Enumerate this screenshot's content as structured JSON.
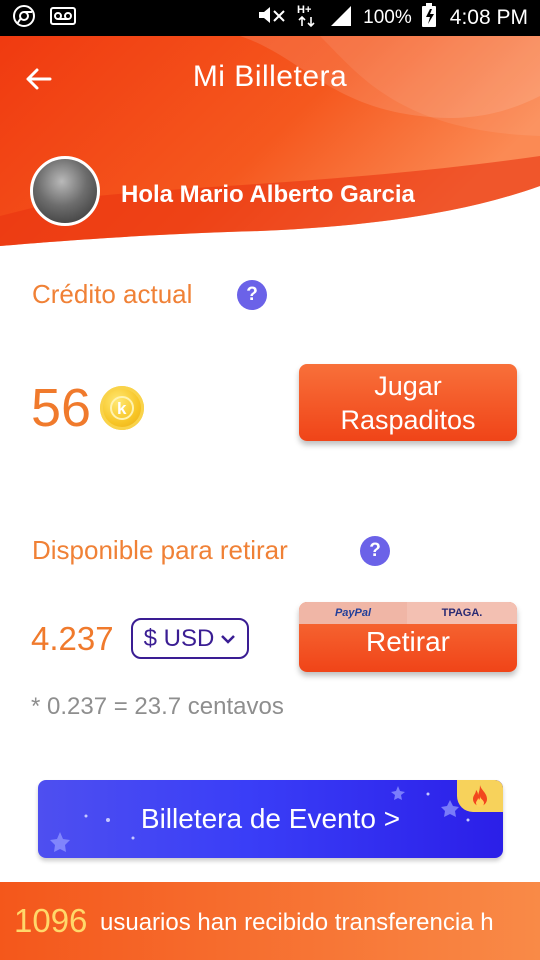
{
  "status_bar": {
    "battery": "100%",
    "time": "4:08 PM"
  },
  "header": {
    "title": "Mi Billetera",
    "greeting": "Hola Mario Alberto Garcia"
  },
  "credit": {
    "label": "Crédito actual",
    "value": "56",
    "play_button": "Jugar Raspaditos"
  },
  "withdraw": {
    "label": "Disponible para retirar",
    "value": "4.237",
    "currency": "$ USD",
    "button": "Retirar",
    "logos": [
      "PayPal",
      "TPAGA."
    ],
    "note": "* 0.237 = 23.7 centavos"
  },
  "event": {
    "label": "Billetera de Evento >"
  },
  "ticker": {
    "count": "1096",
    "text": "usuarios han recibido transferencia h"
  },
  "colors": {
    "accent_orange": "#f04418",
    "label_orange": "#f08136",
    "help_purple": "#6b62e8",
    "event_blue": "#3a3ef7",
    "select_purple": "#3a1d93"
  }
}
